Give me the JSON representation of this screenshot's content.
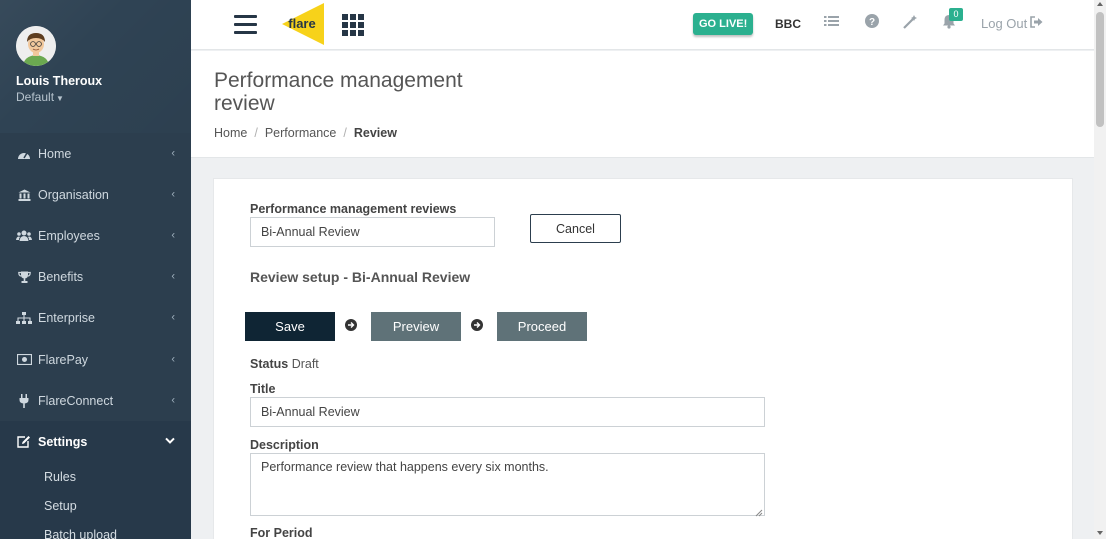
{
  "user": {
    "name": "Louis Theroux",
    "role": "Default"
  },
  "sidebar": {
    "items": [
      {
        "label": "Home",
        "icon": "dashboard-icon"
      },
      {
        "label": "Organisation",
        "icon": "bank-icon"
      },
      {
        "label": "Employees",
        "icon": "users-icon"
      },
      {
        "label": "Benefits",
        "icon": "trophy-icon"
      },
      {
        "label": "Enterprise",
        "icon": "sitemap-icon"
      },
      {
        "label": "FlarePay",
        "icon": "money-icon"
      },
      {
        "label": "FlareConnect",
        "icon": "plug-icon"
      },
      {
        "label": "Settings",
        "icon": "edit-icon"
      }
    ],
    "settings_sub": [
      "Rules",
      "Setup",
      "Batch upload"
    ]
  },
  "topbar": {
    "logo_text": "flare",
    "go_live": "GO LIVE!",
    "company": "BBC",
    "notifications": "0",
    "logout": "Log Out"
  },
  "page": {
    "title": "Performance management review",
    "breadcrumb": [
      "Home",
      "Performance",
      "Review"
    ]
  },
  "form": {
    "reviews_label": "Performance management reviews",
    "reviews_value": "Bi-Annual Review",
    "cancel": "Cancel",
    "section_title": "Review setup - Bi-Annual Review",
    "save": "Save",
    "preview": "Preview",
    "proceed": "Proceed",
    "status_label": "Status",
    "status_value": "Draft",
    "title_label": "Title",
    "title_value": "Bi-Annual Review",
    "description_label": "Description",
    "description_value": "Performance review that happens every six months.",
    "period_label": "For Period"
  },
  "colors": {
    "sidebar": "#2c3e4e",
    "accent": "#2bb08f",
    "logo": "#f7d21a",
    "primary_button": "#0f2534",
    "secondary_button": "#5f7278"
  }
}
